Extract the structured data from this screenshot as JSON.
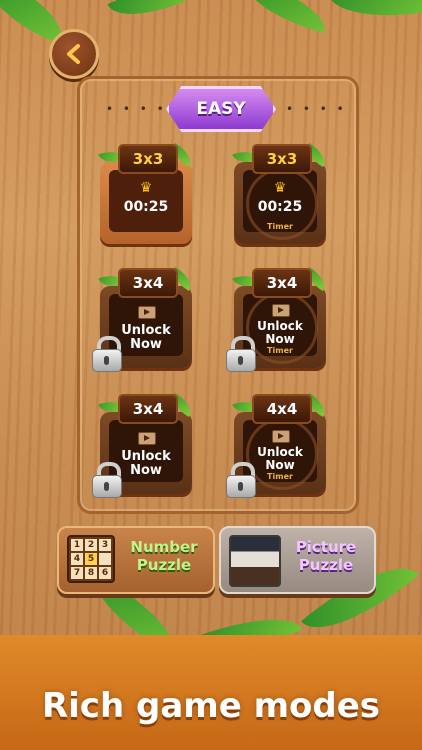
{
  "header": {
    "difficulty_label": "EASY",
    "dots_left": "• • • •",
    "dots_right": "• • • •"
  },
  "cards": [
    {
      "size": "3x3",
      "best_time": "00:25",
      "timer": ""
    },
    {
      "size": "3x3",
      "best_time": "00:25",
      "timer": "Timer"
    },
    {
      "size": "3x4",
      "unlock_line1": "Unlock",
      "unlock_line2": "Now",
      "timer": ""
    },
    {
      "size": "3x4",
      "unlock_line1": "Unlock",
      "unlock_line2": "Now",
      "timer": "Timer"
    },
    {
      "size": "3x4",
      "unlock_line1": "Unlock",
      "unlock_line2": "Now",
      "timer": ""
    },
    {
      "size": "4x4",
      "unlock_line1": "Unlock",
      "unlock_line2": "Now",
      "timer": "Timer"
    }
  ],
  "modes": {
    "number": {
      "line1": "Number",
      "line2": "Puzzle",
      "grid": [
        "1",
        "2",
        "3",
        "4",
        "5",
        "",
        "7",
        "8",
        "6"
      ]
    },
    "picture": {
      "line1": "Picture",
      "line2": "Puzzle"
    }
  },
  "banner": {
    "text": "Rich game modes"
  },
  "colors": {
    "wood": "#c98a4f",
    "accent_purple": "#8e3ad0",
    "gold": "#ffc21a",
    "banner_orange": "#e08a2a"
  },
  "icons": {
    "back": "chevron-left-icon",
    "crown": "crown-icon",
    "play": "play-icon",
    "lock": "padlock-icon"
  }
}
